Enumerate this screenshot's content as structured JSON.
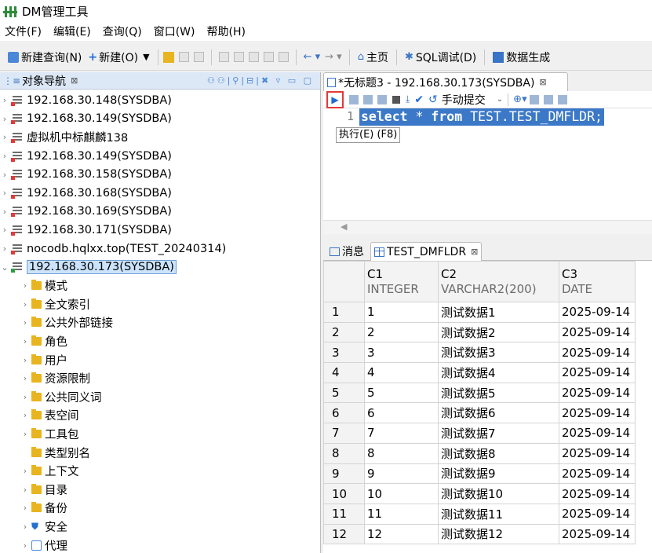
{
  "app": {
    "title": "DM管理工具"
  },
  "menu": [
    "文件(F)",
    "编辑(E)",
    "查询(Q)",
    "窗口(W)",
    "帮助(H)"
  ],
  "toolbar": {
    "new_query": "新建查询(N)",
    "new": "新建(O)",
    "home": "主页",
    "sql_debug": "SQL调试(D)",
    "data_gen": "数据生成"
  },
  "navigator": {
    "title": "对象导航",
    "connections": [
      "192.168.30.148(SYSDBA)",
      "192.168.30.149(SYSDBA)",
      "虚拟机中标麒麟138",
      "192.168.30.149(SYSDBA)",
      "192.168.30.158(SYSDBA)",
      "192.168.30.168(SYSDBA)",
      "192.168.30.169(SYSDBA)",
      "192.168.30.171(SYSDBA)",
      "nocodb.hqlxx.top(TEST_20240314)"
    ],
    "active_connection": "192.168.30.173(SYSDBA)",
    "children": [
      "模式",
      "全文索引",
      "公共外部链接",
      "角色",
      "用户",
      "资源限制",
      "公共同义词",
      "表空间",
      "工具包",
      "类型别名",
      "上下文",
      "目录",
      "备份",
      "安全",
      "代理"
    ]
  },
  "editor": {
    "tab_title": "*无标题3 - 192.168.30.173(SYSDBA)",
    "manual_commit": "手动提交",
    "line_number": "1",
    "sql_kw1": "select",
    "sql_star": " * ",
    "sql_kw2": "from",
    "sql_rest": " TEST.TEST_DMFLDR;",
    "tooltip": "执行(E) (F8)"
  },
  "results": {
    "tab_messages": "消息",
    "tab_table": "TEST_DMFLDR",
    "columns": [
      {
        "name": "C1",
        "type": "INTEGER"
      },
      {
        "name": "C2",
        "type": "VARCHAR2(200)"
      },
      {
        "name": "C3",
        "type": "DATE"
      }
    ],
    "rows": [
      [
        "1",
        "1",
        "测试数据1",
        "2025-09-14"
      ],
      [
        "2",
        "2",
        "测试数据2",
        "2025-09-14"
      ],
      [
        "3",
        "3",
        "测试数据3",
        "2025-09-14"
      ],
      [
        "4",
        "4",
        "测试数据4",
        "2025-09-14"
      ],
      [
        "5",
        "5",
        "测试数据5",
        "2025-09-14"
      ],
      [
        "6",
        "6",
        "测试数据6",
        "2025-09-14"
      ],
      [
        "7",
        "7",
        "测试数据7",
        "2025-09-14"
      ],
      [
        "8",
        "8",
        "测试数据8",
        "2025-09-14"
      ],
      [
        "9",
        "9",
        "测试数据9",
        "2025-09-14"
      ],
      [
        "10",
        "10",
        "测试数据10",
        "2025-09-14"
      ],
      [
        "11",
        "11",
        "测试数据11",
        "2025-09-14"
      ],
      [
        "12",
        "12",
        "测试数据12",
        "2025-09-14"
      ]
    ]
  }
}
